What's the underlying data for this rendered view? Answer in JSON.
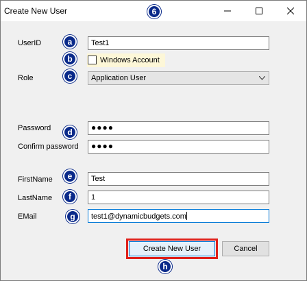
{
  "window": {
    "title": "Create New User",
    "controls": [
      "minimize-icon",
      "maximize-icon",
      "close-icon"
    ]
  },
  "form": {
    "userid_label": "UserID",
    "userid_value": "Test1",
    "windows_account_label": "Windows Account",
    "windows_account_checked": false,
    "role_label": "Role",
    "role_value": "Application User",
    "password_label": "Password",
    "password_value": "●●●●",
    "confirm_password_label": "Confirm password",
    "confirm_password_value": "●●●●",
    "firstname_label": "FirstName",
    "firstname_value": "Test",
    "lastname_label": "LastName",
    "lastname_value": "1",
    "email_label": "EMail",
    "email_value": "test1@dynamicbudgets.com"
  },
  "buttons": {
    "create_label": "Create New User",
    "cancel_label": "Cancel"
  },
  "annotations": {
    "a": "a",
    "b": "b",
    "c": "c",
    "d": "d",
    "e": "e",
    "f": "f",
    "g": "g",
    "h": "h",
    "title": "6"
  },
  "colors": {
    "badge": "#0a2a8a",
    "highlight": "#e0201a",
    "focus_border": "#0078d7",
    "checkbox_highlight": "#fdf7d8"
  }
}
